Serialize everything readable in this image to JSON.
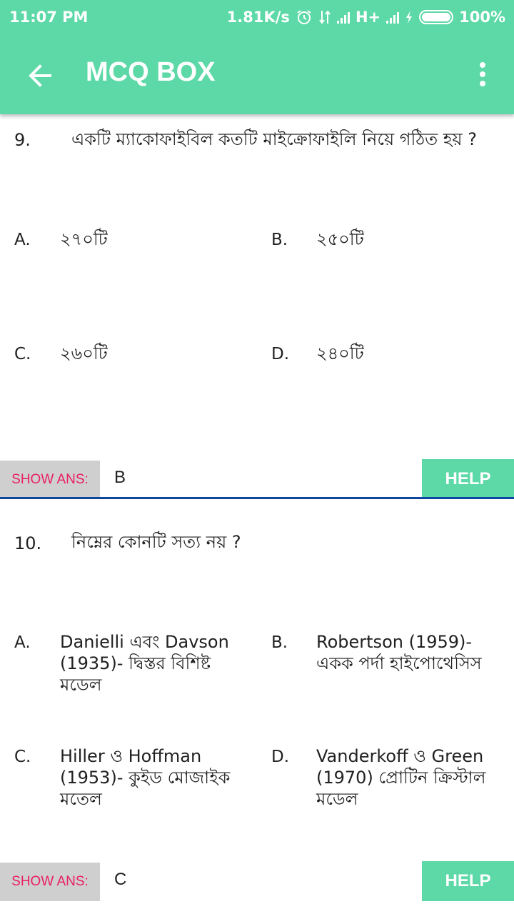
{
  "status_bar": {
    "time": "11:07 PM",
    "speed": "1.81K/s",
    "network": "H+",
    "battery": "100%"
  },
  "toolbar": {
    "title": "MCQ BOX"
  },
  "icons": {
    "back": "arrow-back-icon",
    "menu": "more-vert-icon",
    "alarm": "alarm-icon",
    "data": "data-transfer-icon",
    "signal": "signal-icon",
    "charging": "charging-icon",
    "battery": "battery-icon"
  },
  "colors": {
    "accent": "#5cd9a6",
    "show_ans_text": "#e91e63",
    "divider": "#0d47a1"
  },
  "questions": [
    {
      "number": "9.",
      "text": "একটি ম্যাকোফাইবিল কতটি মাইক্রোফাইলি নিয়ে গঠিত হয় ?",
      "options": [
        {
          "letter": "A.",
          "text": "২৭০টি"
        },
        {
          "letter": "B.",
          "text": "২৫০টি"
        },
        {
          "letter": "C.",
          "text": "২৬০টি"
        },
        {
          "letter": "D.",
          "text": "২৪০টি"
        }
      ],
      "show_ans_label": "SHOW ANS:",
      "answer": "B",
      "help_label": "HELP"
    },
    {
      "number": "10.",
      "text": "নিম্নের কোনটি সত্য নয় ?",
      "options": [
        {
          "letter": "A.",
          "text": "Danielli এবং Davson (1935)- দ্বিস্তর বিশিষ্ট মডেল"
        },
        {
          "letter": "B.",
          "text": "Robertson (1959)- একক পর্দা হাইপোথেসিস"
        },
        {
          "letter": "C.",
          "text": "Hiller ও Hoffman (1953)- কুইড মোজাইক মতেল"
        },
        {
          "letter": "D.",
          "text": "Vanderkoff ও Green (1970) প্রোটিন ক্রিস্টাল মডেল"
        }
      ],
      "show_ans_label": "SHOW ANS:",
      "answer": "C",
      "help_label": "HELP"
    }
  ]
}
